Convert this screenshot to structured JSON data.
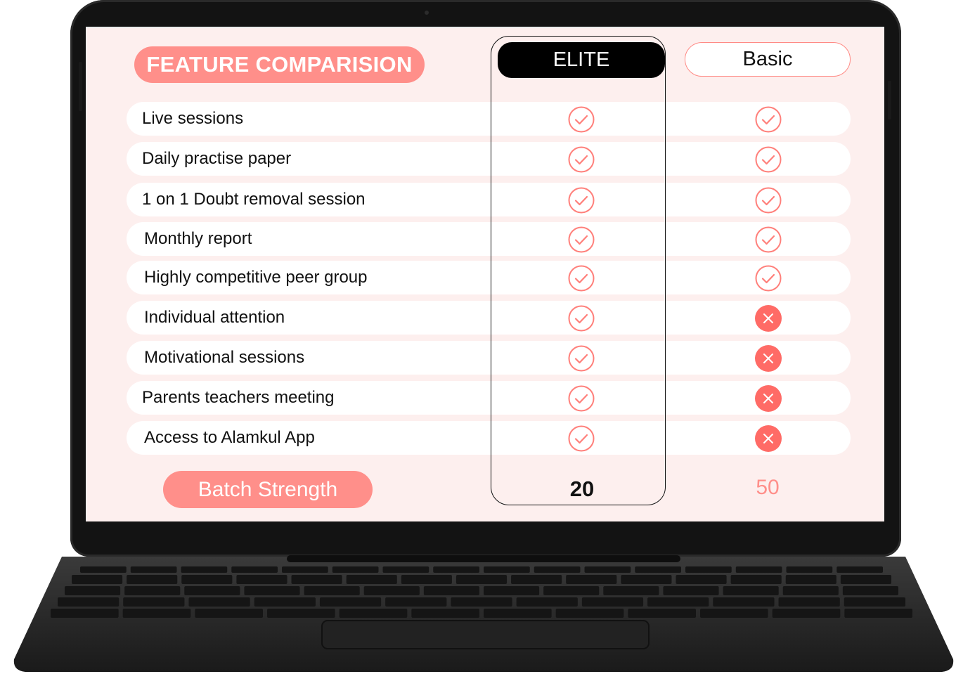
{
  "title": "FEATURE COMPARISION",
  "plans": {
    "elite": "ELITE",
    "basic": "Basic"
  },
  "features": [
    {
      "label": "Live sessions",
      "elite": "check",
      "basic": "check"
    },
    {
      "label": "Daily practise paper",
      "elite": "check",
      "basic": "check"
    },
    {
      "label": "1 on 1 Doubt removal session",
      "elite": "check",
      "basic": "check"
    },
    {
      "label": "Monthly report",
      "elite": "check",
      "basic": "check"
    },
    {
      "label": "Highly competitive peer group",
      "elite": "check",
      "basic": "check"
    },
    {
      "label": "Individual attention",
      "elite": "check",
      "basic": "cross"
    },
    {
      "label": "Motivational sessions",
      "elite": "check",
      "basic": "cross"
    },
    {
      "label": "Parents teachers meeting",
      "elite": "check",
      "basic": "cross"
    },
    {
      "label": "Access to Alamkul App",
      "elite": "check",
      "basic": "cross"
    }
  ],
  "batch_strength": {
    "label": "Batch Strength",
    "elite": "20",
    "basic": "50"
  },
  "icons": {
    "check": "check-circle-icon",
    "cross": "cross-circle-icon"
  },
  "colors": {
    "accent": "#ff8f8a",
    "screen_bg": "#fdefee",
    "elite_header_bg": "#000000"
  }
}
